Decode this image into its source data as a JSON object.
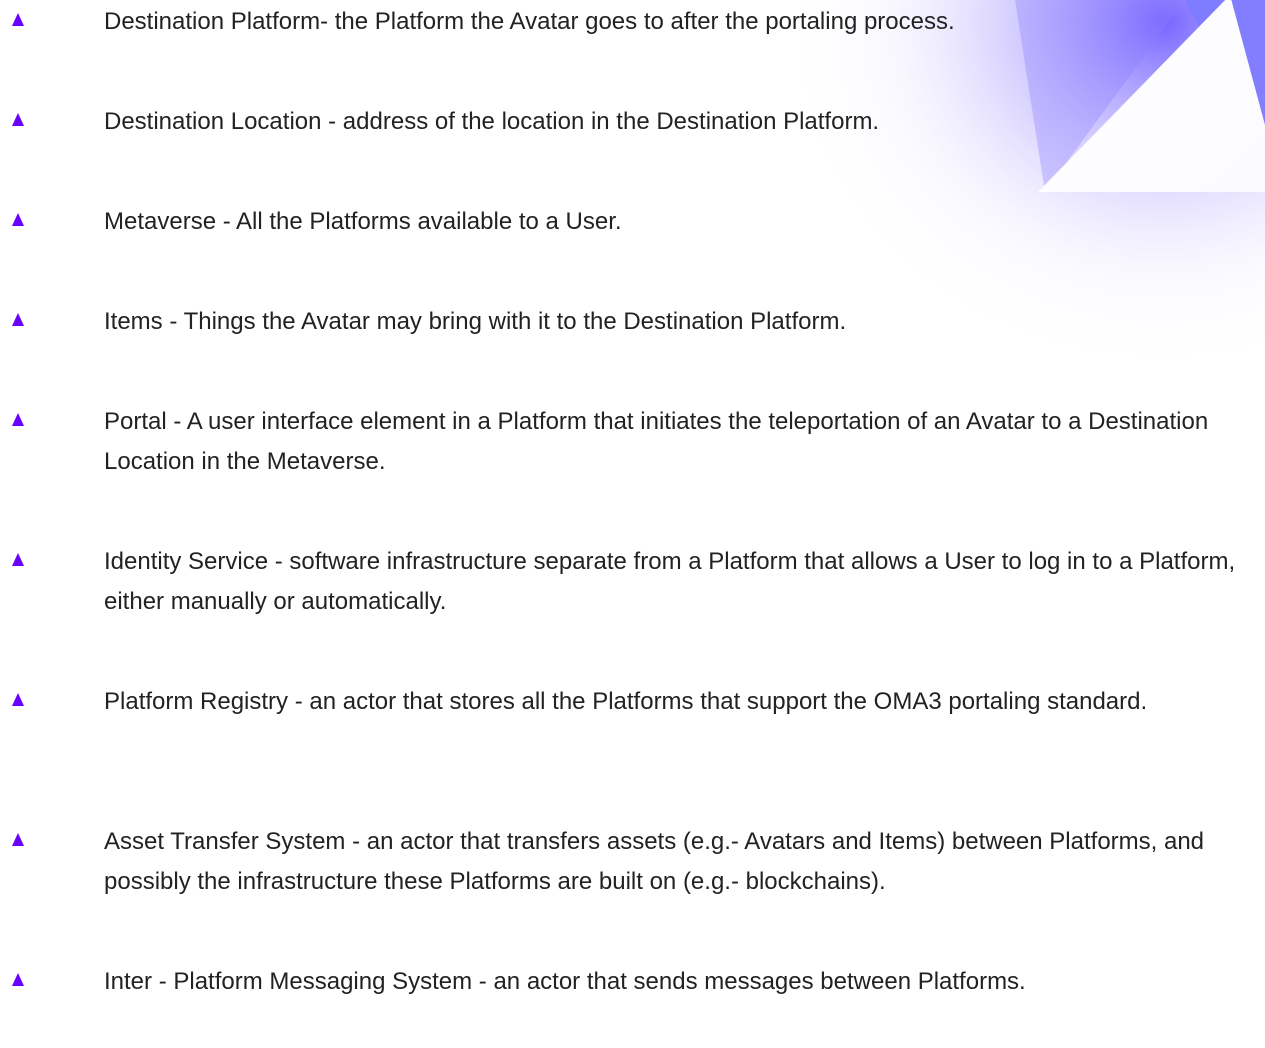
{
  "colors": {
    "bullet": "#6a00ff",
    "accent_gradient_start": "#7b6cff",
    "accent_gradient_end": "#ffffff"
  },
  "decoration": {
    "icon": "triangle-gradient-decoration"
  },
  "definitions": [
    {
      "text": "Destination Platform- the Platform the Avatar goes to after the portaling process."
    },
    {
      "text": "Destination Location - address of the location in the Destination Platform."
    },
    {
      "text": "Metaverse - All the Platforms available to a User."
    },
    {
      "text": "Items - Things the Avatar may bring with it to the Destination Platform."
    },
    {
      "text": "Portal - A user interface element in a Platform that initiates the teleportation of an Avatar to a Destination Location in the Metaverse."
    },
    {
      "text": "Identity Service - software infrastructure separate from a Platform that allows a User to log in to a Platform, either manually or automatically."
    },
    {
      "text": "Platform Registry - an actor that stores all the Platforms that support the OMA3 portaling standard."
    },
    {
      "text": "Asset Transfer System - an actor that transfers assets (e.g.- Avatars and Items) between Platforms, and possibly the infrastructure these Platforms are built on (e.g.- blockchains)."
    },
    {
      "text": "Inter - Platform Messaging System - an actor that sends messages between Platforms."
    }
  ]
}
